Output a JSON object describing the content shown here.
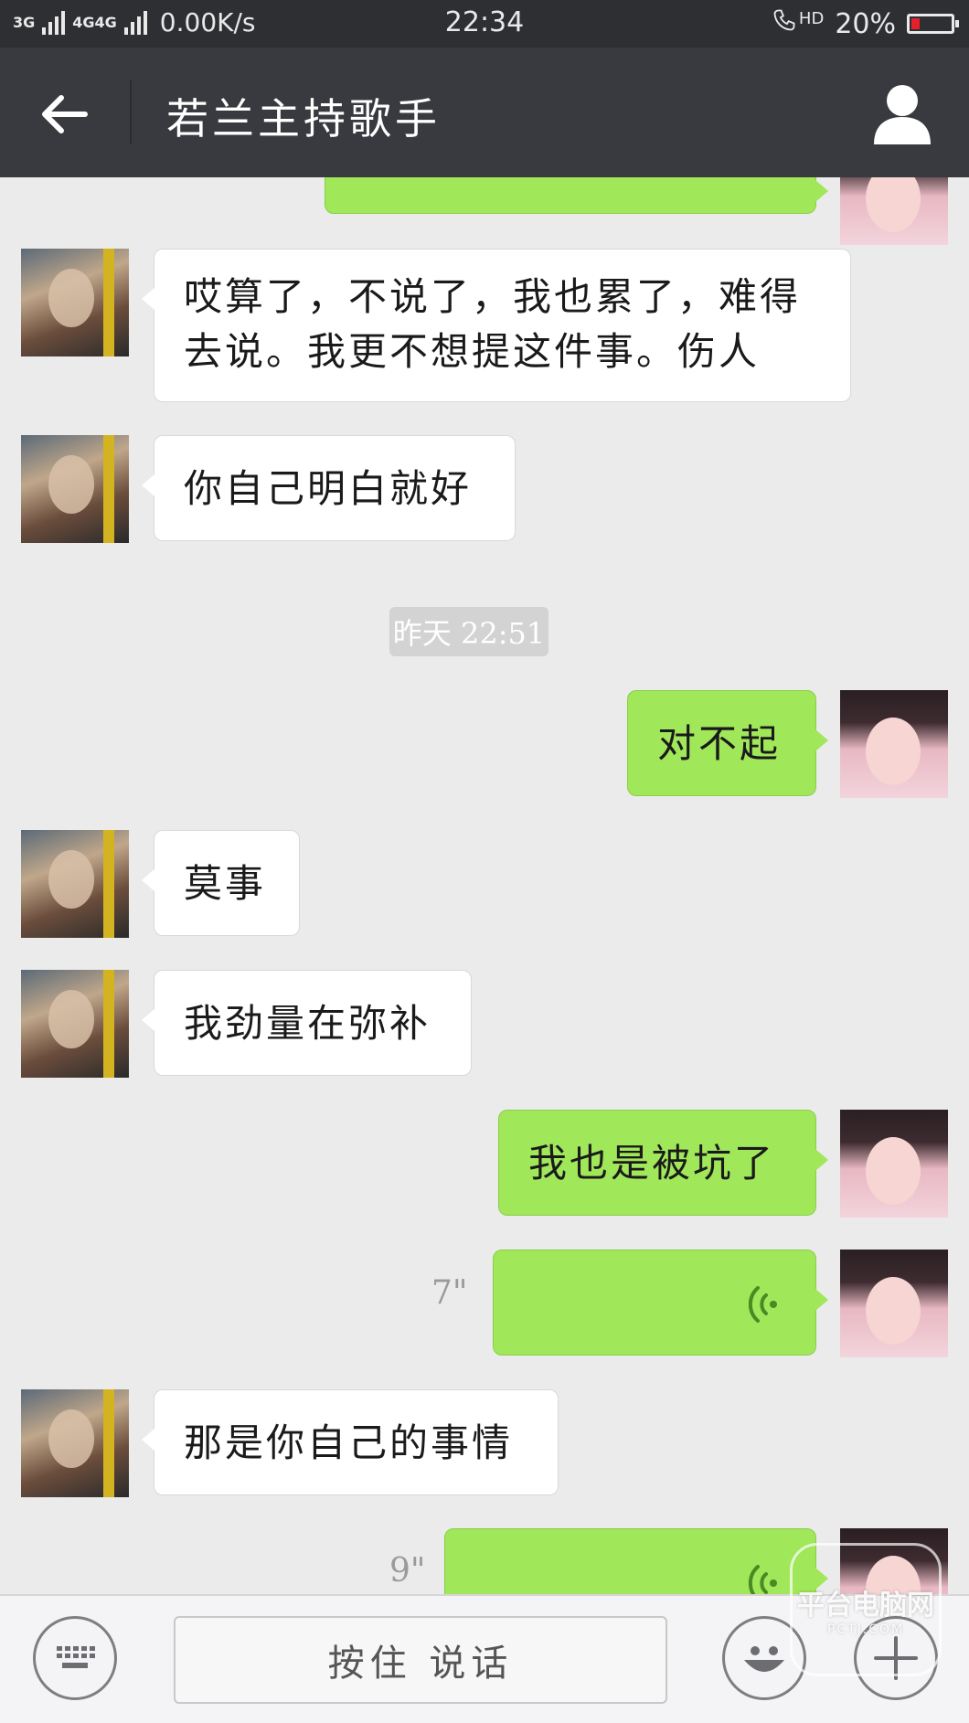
{
  "status_bar": {
    "net_type_1": "3G",
    "net_type_2": "4G4G",
    "speed": "0.00K/s",
    "time": "22:34",
    "hd": "HD",
    "battery": "20%",
    "battery_level": 0.2,
    "battery_color": "#e6202a"
  },
  "header": {
    "title": "若兰主持歌手",
    "back_icon": "arrow-left-icon",
    "profile_icon": "person-icon"
  },
  "messages": [
    {
      "side": "out",
      "type": "text",
      "text": ""
    },
    {
      "side": "in",
      "type": "text",
      "text": "哎算了，不说了，我也累了，难得去说。我更不想提这件事。伤人"
    },
    {
      "side": "in",
      "type": "text",
      "text": "你自己明白就好"
    },
    {
      "side": "time",
      "text": "昨天 22:51"
    },
    {
      "side": "out",
      "type": "text",
      "text": "对不起"
    },
    {
      "side": "in",
      "type": "text",
      "text": "莫事"
    },
    {
      "side": "in",
      "type": "text",
      "text": "我劲量在弥补"
    },
    {
      "side": "out",
      "type": "text",
      "text": "我也是被坑了"
    },
    {
      "side": "out",
      "type": "voice",
      "duration": "7\""
    },
    {
      "side": "in",
      "type": "text",
      "text": "那是你自己的事情"
    },
    {
      "side": "out",
      "type": "voice",
      "duration": "9\""
    }
  ],
  "input_bar": {
    "hold_to_talk": "按住 说话",
    "keyboard_icon": "keyboard-icon",
    "emoji_icon": "smiley-icon",
    "plus_icon": "plus-icon"
  },
  "watermark": {
    "text": "平台电脑网",
    "sub": "PCTJ.COM"
  },
  "colors": {
    "title_bar": "#393a3f",
    "outgoing_bubble": "#a0e75a",
    "incoming_bubble": "#ffffff",
    "chat_background": "#ebebeb"
  }
}
